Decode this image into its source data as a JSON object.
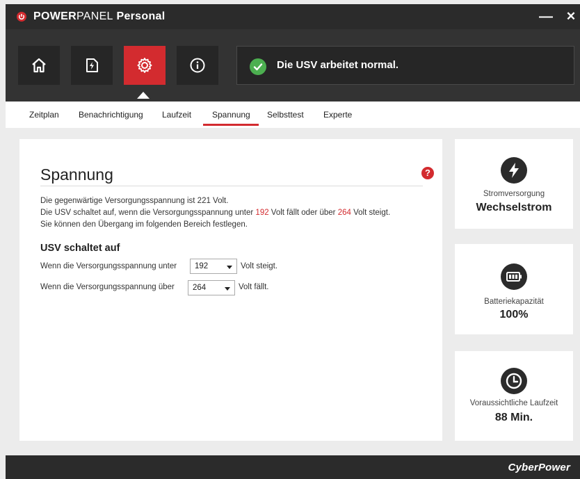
{
  "app": {
    "title_bold": "POWER",
    "title_light": "PANEL",
    "title_suffix": " Personal",
    "minimize_glyph": "—",
    "close_glyph": "✕"
  },
  "toolbar": {
    "buttons": [
      {
        "name": "home-icon",
        "active": false
      },
      {
        "name": "power-file-icon",
        "active": false
      },
      {
        "name": "gear-icon",
        "active": true
      },
      {
        "name": "info-icon",
        "active": false
      }
    ],
    "status_text": "Die USV arbeitet normal.",
    "status_icon": "check-icon",
    "status_color": "#4caf50"
  },
  "tabs": [
    {
      "label": "Zeitplan"
    },
    {
      "label": "Benachrichtigung"
    },
    {
      "label": "Laufzeit"
    },
    {
      "label": "Spannung",
      "active": true
    },
    {
      "label": "Selbsttest"
    },
    {
      "label": "Experte"
    }
  ],
  "panel": {
    "title": "Spannung",
    "help_glyph": "?",
    "line1": "Die gegenwärtige Versorgungsspannung ist 221 Volt.",
    "line2_a": "Die USV schaltet auf, wenn die Versorgungsspannung unter ",
    "line2_low": "192",
    "line2_b": " Volt fällt oder über ",
    "line2_high": "264",
    "line2_c": " Volt steigt.",
    "line3": "Sie können den Übergang im folgenden Bereich festlegen.",
    "section_title": "USV schaltet auf",
    "row1_label": "Wenn die Versorgungsspannung unter",
    "row1_value": "192",
    "row1_suffix": "Volt steigt.",
    "row2_label": "Wenn die Versorgungsspannung über",
    "row2_value": "264",
    "row2_suffix": "Volt fällt."
  },
  "cards": [
    {
      "icon": "lightning-icon",
      "label": "Stromversorgung",
      "value": "Wechselstrom"
    },
    {
      "icon": "battery-icon",
      "label": "Batteriekapazität",
      "value": "100%"
    },
    {
      "icon": "clock-icon",
      "label": "Voraussichtliche Laufzeit",
      "value": "88 Min."
    }
  ],
  "footer": {
    "brand": "CyberPower"
  },
  "colors": {
    "accent": "#d32b2f",
    "dark": "#2b2b2b",
    "ok": "#4caf50"
  }
}
